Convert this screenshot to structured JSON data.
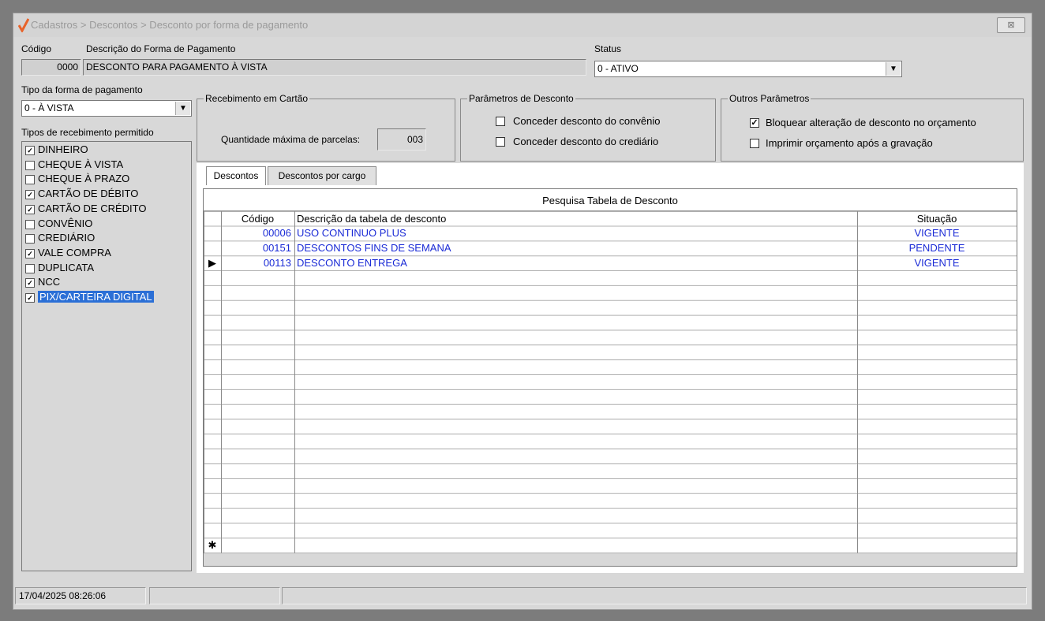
{
  "window": {
    "breadcrumb": "Cadastros > Descontos > Desconto por forma de pagamento",
    "close_label": "⊠"
  },
  "header": {
    "codigo_label": "Código",
    "codigo_value": "0000",
    "descricao_label": "Descrição do Forma de Pagamento",
    "descricao_value": "DESCONTO PARA PAGAMENTO À VISTA",
    "status_label": "Status",
    "status_value": "0 - ATIVO"
  },
  "payment_type": {
    "label": "Tipo da forma de pagamento",
    "value": "0 - À VISTA"
  },
  "receipt_types": {
    "label": "Tipos de recebimento permitido",
    "items": [
      {
        "label": "DINHEIRO",
        "checked": true
      },
      {
        "label": "CHEQUE À VISTA",
        "checked": false
      },
      {
        "label": "CHEQUE À PRAZO",
        "checked": false
      },
      {
        "label": "CARTÃO DE DÉBITO",
        "checked": true
      },
      {
        "label": "CARTÃO DE CRÉDITO",
        "checked": true
      },
      {
        "label": "CONVÊNIO",
        "checked": false
      },
      {
        "label": "CREDIÁRIO",
        "checked": false
      },
      {
        "label": "VALE COMPRA",
        "checked": true
      },
      {
        "label": "DUPLICATA",
        "checked": false
      },
      {
        "label": "NCC",
        "checked": true
      },
      {
        "label": "PIX/CARTEIRA DIGITAL",
        "checked": true,
        "selected": true
      }
    ]
  },
  "card_group": {
    "title": "Recebimento em Cartão",
    "max_installments_label": "Quantidade máxima de parcelas:",
    "max_installments_value": "003"
  },
  "discount_params": {
    "title": "Parâmetros de Desconto",
    "options": [
      {
        "label": "Conceder desconto do convênio",
        "checked": false
      },
      {
        "label": "Conceder desconto do crediário",
        "checked": false
      }
    ]
  },
  "other_params": {
    "title": "Outros Parâmetros",
    "options": [
      {
        "label": "Bloquear alteração de desconto no orçamento",
        "checked": true
      },
      {
        "label": "Imprimir orçamento após a gravação",
        "checked": false
      }
    ]
  },
  "tabs": [
    {
      "label": "Descontos",
      "active": true
    },
    {
      "label": "Descontos por cargo",
      "active": false
    }
  ],
  "grid": {
    "title": "Pesquisa Tabela de Desconto",
    "columns": [
      "Código",
      "Descrição da tabela de desconto",
      "Situação"
    ],
    "rows": [
      {
        "codigo": "00006",
        "descricao": "USO CONTINUO PLUS",
        "situacao": "VIGENTE"
      },
      {
        "codigo": "00151",
        "descricao": "DESCONTOS FINS DE SEMANA",
        "situacao": "PENDENTE"
      },
      {
        "codigo": "00113",
        "descricao": "DESCONTO ENTREGA",
        "situacao": "VIGENTE"
      }
    ],
    "current_row_marker": "▶",
    "new_row_marker": "✱"
  },
  "statusbar": {
    "datetime": "17/04/2025 08:26:06"
  },
  "colors": {
    "accent_logo": "#e8632a",
    "selection": "#2b6fd6",
    "grid_text": "#1b2bd6"
  }
}
